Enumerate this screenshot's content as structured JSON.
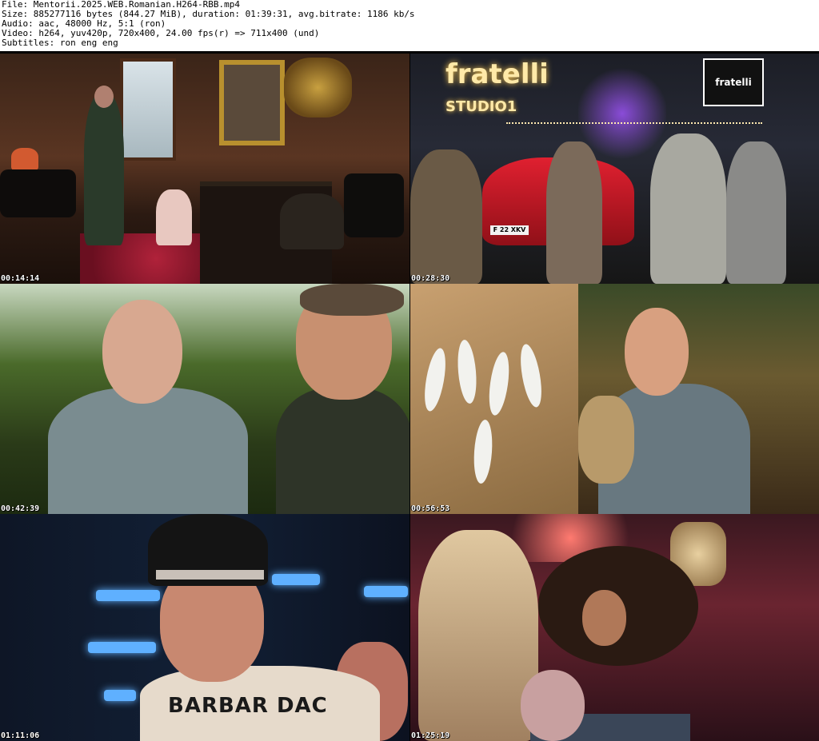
{
  "header": {
    "file_line": "File: Mentorii.2025.WEB.Romanian.H264-RBB.mp4",
    "size_line": "Size: 885277116 bytes (844.27 MiB), duration: 01:39:31, avg.bitrate: 1186 kb/s",
    "audio_line": "Audio: aac, 48000 Hz, 5:1 (ron)",
    "video_line": "Video: h264, yuv420p, 720x400, 24.00 fps(r) => 711x400 (und)",
    "subtitles_line": "Subtitles: ron eng eng"
  },
  "frames": [
    {
      "timestamp": "00:14:14"
    },
    {
      "timestamp": "00:28:30",
      "sign_main": "fratelli",
      "sign_sub": "STUDIO1",
      "sign_logo": "fratelli",
      "plate": "F 22 XKV"
    },
    {
      "timestamp": "00:42:39"
    },
    {
      "timestamp": "00:56:53"
    },
    {
      "timestamp": "01:11:06",
      "shirt_print": "BARBAR DAC"
    },
    {
      "timestamp": "01:25:19"
    }
  ]
}
